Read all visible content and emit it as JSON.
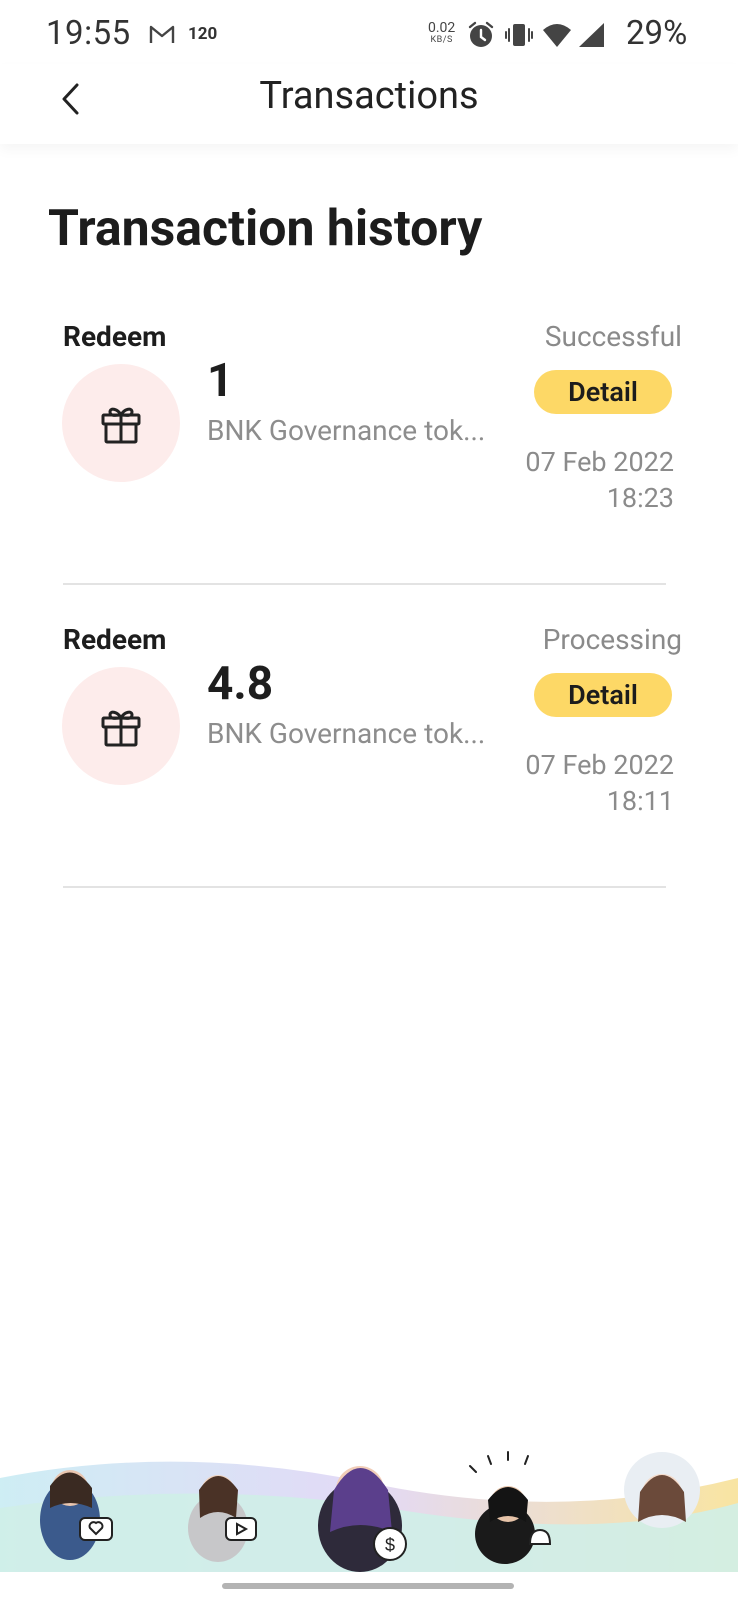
{
  "status_bar": {
    "time": "19:55",
    "notif_count": "120",
    "speed_value": "0.02",
    "speed_unit": "KB/S",
    "battery": "29%"
  },
  "header": {
    "title": "Transactions"
  },
  "page_title": "Transaction history",
  "transactions": [
    {
      "type": "Redeem",
      "status": "Successful",
      "amount": "1",
      "token": "BNK Governance tok...",
      "detail_label": "Detail",
      "date": "07 Feb 2022",
      "time": "18:23"
    },
    {
      "type": "Redeem",
      "status": "Processing",
      "amount": "4.8",
      "token": "BNK Governance tok...",
      "detail_label": "Detail",
      "date": "07 Feb 2022",
      "time": "18:11"
    }
  ],
  "colors": {
    "accent": "#fdd866",
    "icon_bg": "#fdeceb",
    "muted_text": "#8a8a8a"
  }
}
